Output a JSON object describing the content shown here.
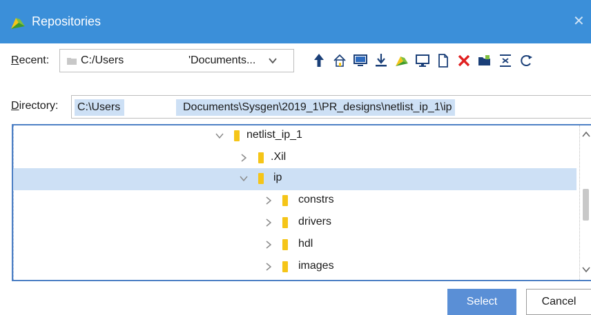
{
  "window": {
    "title": "Repositories"
  },
  "recent": {
    "label_key": "R",
    "label_rest": "ecent:",
    "value_left": "C:/Users",
    "value_right": "'Documents..."
  },
  "toolbar": {
    "icons": [
      "up-arrow-icon",
      "home-icon",
      "desktop-icon",
      "download-icon",
      "vivado-project-icon",
      "monitor-icon",
      "new-file-icon",
      "delete-icon",
      "new-folder-icon",
      "collapse-icon",
      "refresh-icon"
    ],
    "colors": {
      "accent": "#2d6bbf",
      "delete": "#e02020",
      "folder": "#f5c518"
    }
  },
  "directory": {
    "label_key": "D",
    "label_rest": "irectory:",
    "value_left": "C:\\Users",
    "value_right": "Documents\\Sysgen\\2019_1\\PR_designs\\netlist_ip_1\\ip"
  },
  "tree": {
    "items": [
      {
        "label": "netlist_ip_1",
        "expanded": true,
        "selected": false
      },
      {
        "label": ".Xil",
        "expanded": false,
        "selected": false
      },
      {
        "label": "ip",
        "expanded": true,
        "selected": true
      },
      {
        "label": "constrs",
        "expanded": false,
        "selected": false
      },
      {
        "label": "drivers",
        "expanded": false,
        "selected": false
      },
      {
        "label": "hdl",
        "expanded": false,
        "selected": false
      },
      {
        "label": "images",
        "expanded": false,
        "selected": false
      }
    ]
  },
  "buttons": {
    "select": "Select",
    "cancel": "Cancel"
  },
  "colors": {
    "titlebar": "#3b8fd9",
    "selection": "#cde0f5",
    "primary_button": "#5a8fd6"
  }
}
